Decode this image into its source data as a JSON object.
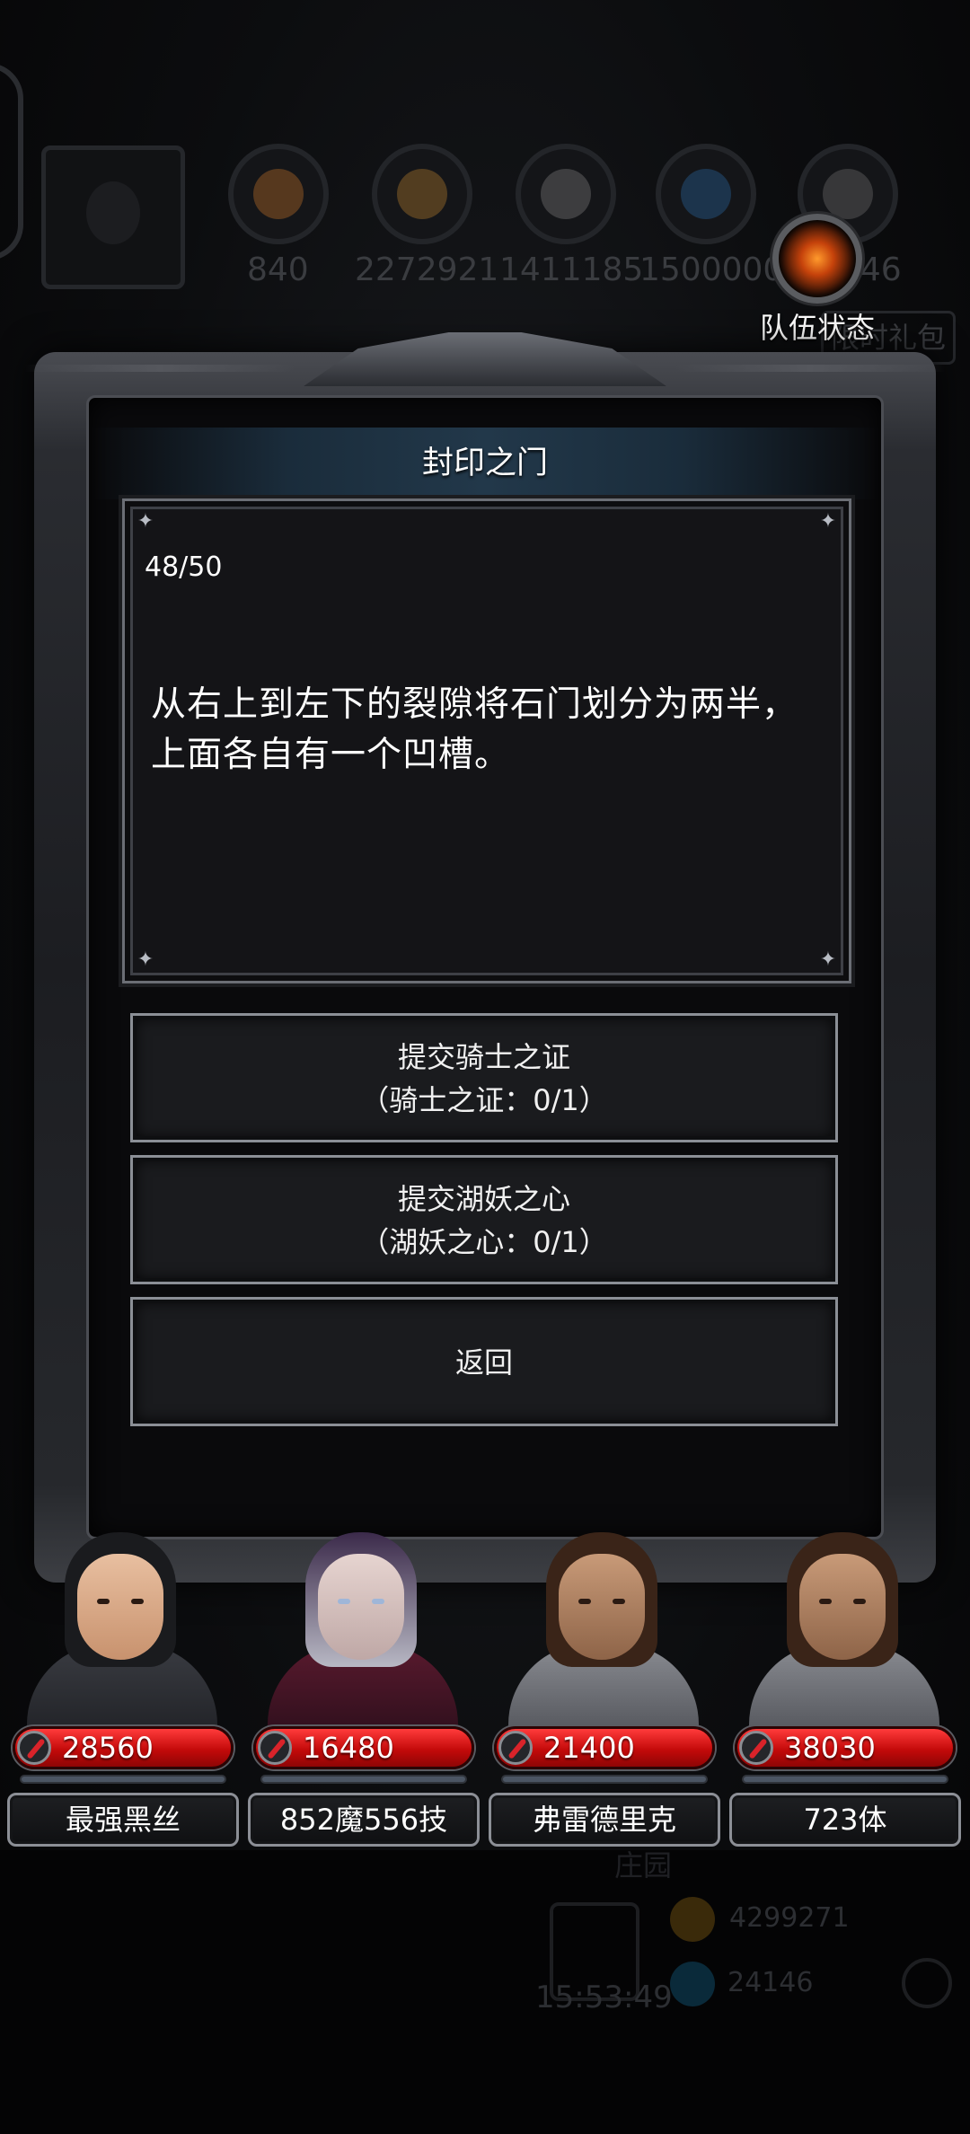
{
  "hud": {
    "resources": [
      "840",
      "2272921",
      "1411185",
      "1500000",
      "546"
    ],
    "gift_label": "限时礼包",
    "team_status_label": "队伍状态"
  },
  "dialog": {
    "title": "封印之门",
    "progress": "48/50",
    "story_line1": "从右上到左下的裂隙将石门划分为两半，",
    "story_line2": "上面各自有一个凹槽。",
    "choices": [
      {
        "line1": "提交骑士之证",
        "line2": "（骑士之证：0/1）"
      },
      {
        "line1": "提交湖妖之心",
        "line2": "（湖妖之心：0/1）"
      },
      {
        "line1": "返回",
        "line2": ""
      }
    ]
  },
  "heroes": [
    {
      "hp": "28560",
      "name": "最强黑丝"
    },
    {
      "hp": "16480",
      "name": "852魔556技"
    },
    {
      "hp": "21400",
      "name": "弗雷德里克"
    },
    {
      "hp": "38030",
      "name": "723体"
    }
  ],
  "bottom": {
    "timer": "15:53:49",
    "currency1": "4299271",
    "currency2": "24146",
    "ghost_text": "庄园"
  },
  "colors": {
    "hp_red": "#c40a0a",
    "title_bar": "#22384a",
    "frame_border": "#8b8f96"
  }
}
